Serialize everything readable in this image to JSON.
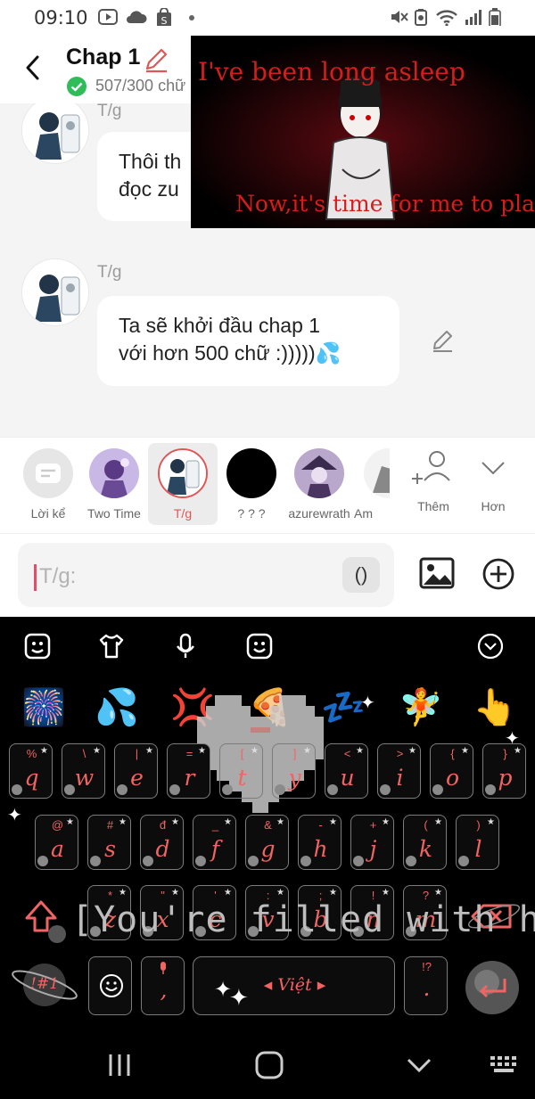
{
  "status_bar": {
    "time": "09:10",
    "icons": [
      "youtube-icon",
      "cloud-icon",
      "shopee-icon",
      "dot-icon",
      "mute-icon",
      "battery-saver-icon",
      "wifi-icon",
      "signal-icon",
      "battery-icon"
    ]
  },
  "header": {
    "title": "Chap 1",
    "word_count": "507/300 chữ"
  },
  "chat": {
    "messages": [
      {
        "sender": "T/g",
        "text_line1": "Thôi th",
        "text_line2": "đọc zu"
      },
      {
        "sender": "T/g",
        "text_line1": "Ta sẽ khởi đầu chap 1",
        "text_line2": "với hơn 500 chữ :)))))💦"
      }
    ]
  },
  "video_overlay": {
    "caption_top": "I've been long asleep",
    "caption_bottom": "Now,it's time for me to play"
  },
  "characters": [
    {
      "name": "Lời kể",
      "selected": false
    },
    {
      "name": "Two Time",
      "selected": false
    },
    {
      "name": "T/g",
      "selected": true
    },
    {
      "name": "? ? ?",
      "selected": false
    },
    {
      "name": "azurewrath",
      "selected": false
    },
    {
      "name": "Am",
      "selected": false
    }
  ],
  "actions": {
    "add_label": "Thêm",
    "more_label": "Hơn"
  },
  "composer": {
    "placeholder": "T/g:",
    "paren_label": "()"
  },
  "keyboard": {
    "toolbar_icons": [
      "sticker-icon",
      "shirt-icon",
      "mic-icon",
      "emoji-icon",
      "collapse-icon"
    ],
    "emoji_row": [
      "🎆",
      "💦",
      "💢",
      "🍕",
      "💤",
      "🧚",
      "👆"
    ],
    "rows": [
      [
        [
          "q",
          "%"
        ],
        [
          "w",
          "\\"
        ],
        [
          "e",
          "|"
        ],
        [
          "r",
          "="
        ],
        [
          "t",
          "["
        ],
        [
          "y",
          "]"
        ],
        [
          "u",
          "<"
        ],
        [
          "i",
          ">"
        ],
        [
          "o",
          "{"
        ],
        [
          "p",
          "}"
        ]
      ],
      [
        [
          "a",
          "@"
        ],
        [
          "s",
          "#"
        ],
        [
          "d",
          "đ"
        ],
        [
          "f",
          "_"
        ],
        [
          "g",
          "&"
        ],
        [
          "h",
          "-"
        ],
        [
          "j",
          "+"
        ],
        [
          "k",
          "("
        ],
        [
          "l",
          ")"
        ]
      ],
      [
        [
          "z",
          "*"
        ],
        [
          "x",
          "\""
        ],
        [
          "c",
          "'"
        ],
        [
          "v",
          ":"
        ],
        [
          "b",
          ";"
        ],
        [
          "n",
          "!"
        ],
        [
          "m",
          "?"
        ]
      ]
    ],
    "sym_label": "!#1",
    "comma": ",",
    "space_label": "◂ Việt ▸",
    "punct": ".",
    "punct_sub": "!?",
    "overlay_text": "[You're filled with hope]"
  },
  "colors": {
    "accent": "#e05656",
    "key_text": "#f06464",
    "chat_bg": "#f4f4f5"
  }
}
